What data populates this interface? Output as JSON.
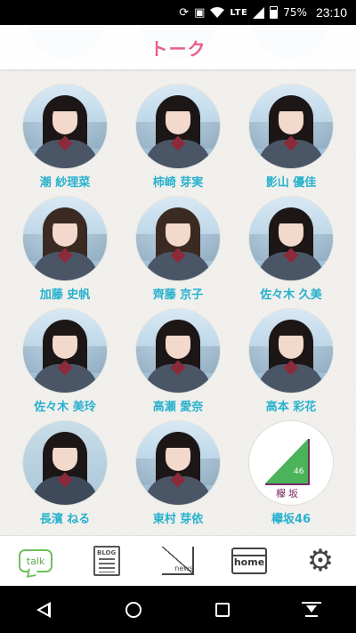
{
  "status_bar": {
    "icons": [
      "rotate-icon",
      "nfc-icon",
      "wifi-icon",
      "signal-icon",
      "battery-icon"
    ],
    "network": "LTE",
    "battery": "75%",
    "time": "23:10"
  },
  "header": {
    "title": "トーク"
  },
  "members": [
    {
      "name": "潮 紗理菜"
    },
    {
      "name": "柿崎 芽実"
    },
    {
      "name": "影山 優佳"
    },
    {
      "name": "加藤 史帆"
    },
    {
      "name": "齊藤 京子"
    },
    {
      "name": "佐々木 久美"
    },
    {
      "name": "佐々木 美玲"
    },
    {
      "name": "高瀬 愛奈"
    },
    {
      "name": "高本 彩花"
    },
    {
      "name": "長濱 ねる"
    },
    {
      "name": "東村 芽依"
    },
    {
      "name": "欅坂46"
    }
  ],
  "logo": {
    "number": "46",
    "text": "欅坂"
  },
  "tabs": {
    "talk_label": "talk",
    "blog_label": "BLOG",
    "news_label": "news",
    "home_label": "home"
  },
  "colors": {
    "accent_pink": "#e8608a",
    "name_cyan": "#27b1cd",
    "talk_green": "#6fc05a",
    "logo_green": "#4bb35a",
    "logo_purple": "#7a2a66"
  }
}
